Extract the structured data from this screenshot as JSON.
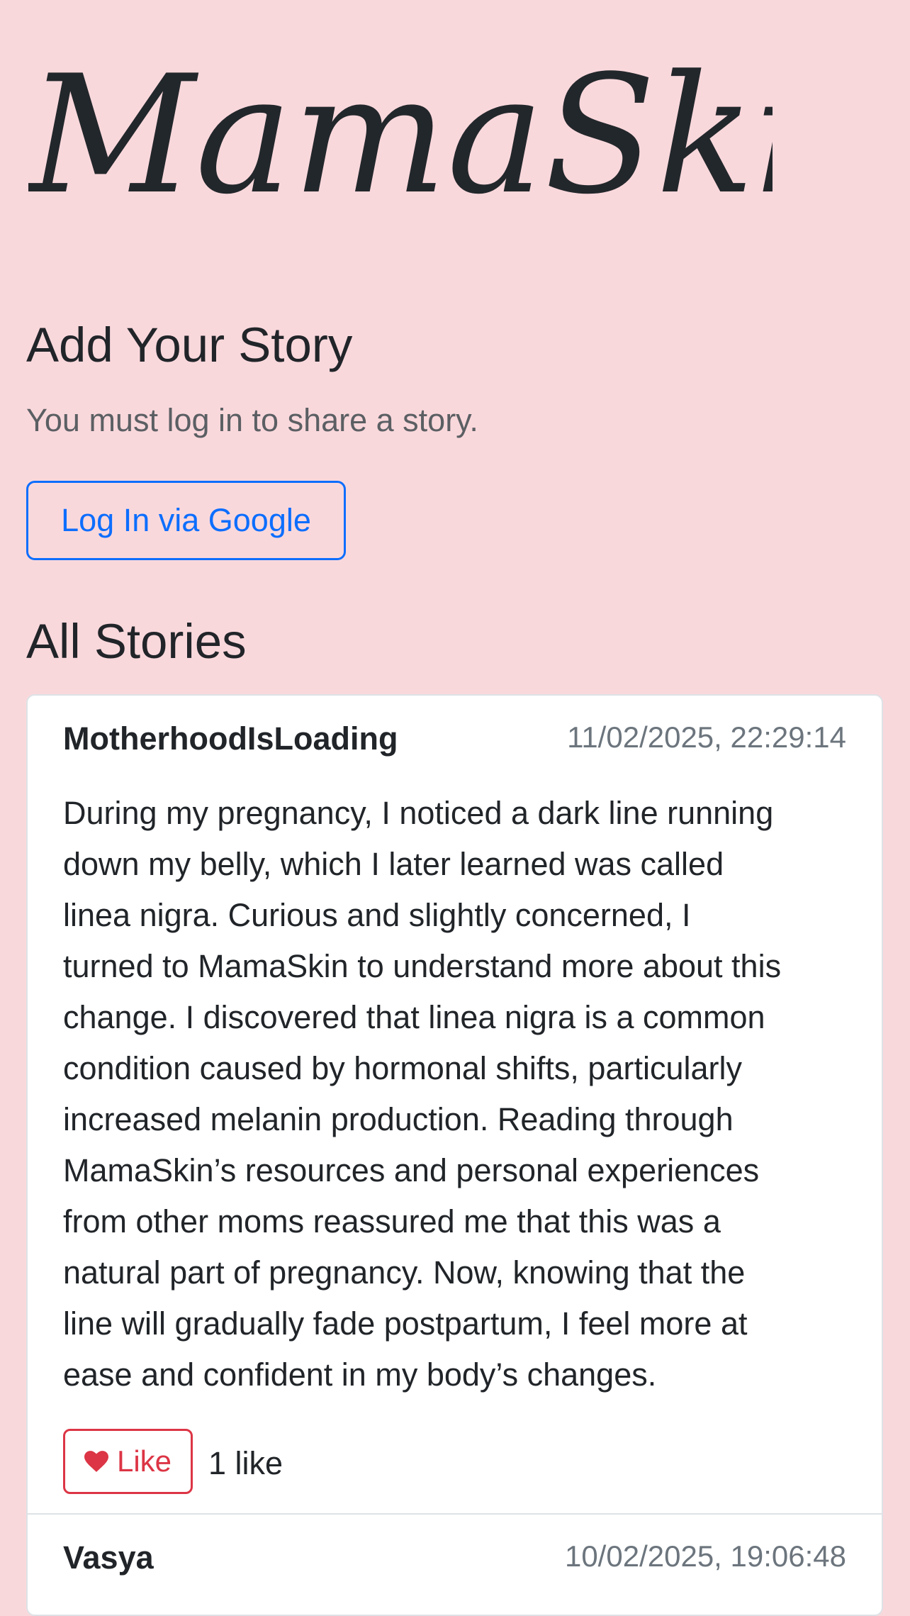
{
  "brand": {
    "logo_text": "MamaSkin"
  },
  "add_story": {
    "title": "Add Your Story",
    "login_note": "You must log in to share a story.",
    "login_button": "Log In via Google"
  },
  "all_stories": {
    "title": "All Stories",
    "stories": [
      {
        "author": "MotherhoodIsLoading",
        "date": "11/02/2025, 22:29:14",
        "text": "During my pregnancy, I noticed a dark line running\ndown my belly, which I later learned was called\nlinea nigra. Curious and slightly concerned, I\nturned to MamaSkin to understand more about this\nchange. I discovered that linea nigra is a common\ncondition caused by hormonal shifts, particularly\nincreased melanin production. Reading through\nMamaSkin’s resources and personal experiences\nfrom other moms reassured me that this was a\nnatural part of pregnancy. Now, knowing that the\nline will gradually fade postpartum, I feel more at\nease and confident in my body’s changes.",
        "like_label": "Like",
        "like_count": "1 like"
      },
      {
        "author": "Vasya",
        "date": "10/02/2025, 19:06:48"
      }
    ]
  },
  "colors": {
    "background": "#f9d8dc",
    "primary": "#0d6efd",
    "danger": "#dc3545"
  },
  "icons": {
    "like": "heart-icon"
  }
}
